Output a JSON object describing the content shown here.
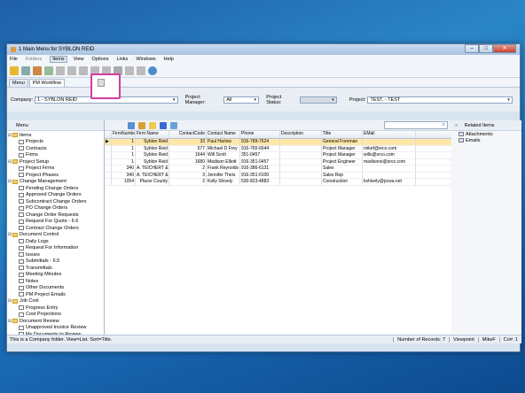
{
  "window": {
    "title": "1 Main Menu for SYBLON REID",
    "minimize": "–",
    "maximize": "□",
    "close": "✕"
  },
  "menubar": [
    {
      "label": "File"
    },
    {
      "label": "Folders"
    },
    {
      "label": "Items"
    },
    {
      "label": "View"
    },
    {
      "label": "Options"
    },
    {
      "label": "Links"
    },
    {
      "label": "Windows"
    },
    {
      "label": "Help"
    }
  ],
  "tabs": [
    {
      "label": "Menu"
    },
    {
      "label": "PM Workflow"
    }
  ],
  "filters": {
    "company_label": "Company:",
    "company_value": "1 - SYBLON REID",
    "pm_label": "Project Manager:",
    "pm_value": "All",
    "status_label": "Project Status:",
    "status_value": "",
    "project_label": "Project:",
    "project_value": "TEST. - TEST"
  },
  "left": {
    "header": "Menu",
    "tree": [
      {
        "label": "Items",
        "level": 0,
        "type": "folder"
      },
      {
        "label": "Projects",
        "level": 1
      },
      {
        "label": "Contracts",
        "level": 1
      },
      {
        "label": "Firms",
        "level": 1
      },
      {
        "label": "Project Setup",
        "level": 0,
        "type": "folder"
      },
      {
        "label": "Project Firms",
        "level": 1
      },
      {
        "label": "Project Phases",
        "level": 1
      },
      {
        "label": "Change Management",
        "level": 0,
        "type": "folder"
      },
      {
        "label": "Pending Change Orders",
        "level": 1
      },
      {
        "label": "Approved Change Orders",
        "level": 1
      },
      {
        "label": "Subcontract Change Orders",
        "level": 1
      },
      {
        "label": "PO Change Orders",
        "level": 1
      },
      {
        "label": "Change Order Requests",
        "level": 1
      },
      {
        "label": "Request For Quote - 6.6",
        "level": 1
      },
      {
        "label": "Contract Change Orders",
        "level": 1
      },
      {
        "label": "Document Control",
        "level": 0,
        "type": "folder"
      },
      {
        "label": "Daily Logs",
        "level": 1
      },
      {
        "label": "Request For Information",
        "level": 1
      },
      {
        "label": "Issues",
        "level": 1
      },
      {
        "label": "Submittals - 6.5",
        "level": 1
      },
      {
        "label": "Transmittals",
        "level": 1
      },
      {
        "label": "Meeting Minutes",
        "level": 1
      },
      {
        "label": "Notes",
        "level": 1
      },
      {
        "label": "Other Documents",
        "level": 1
      },
      {
        "label": "PM Project Emails",
        "level": 1
      },
      {
        "label": "Job Cost",
        "level": 0,
        "type": "folder"
      },
      {
        "label": "Progress Entry",
        "level": 1
      },
      {
        "label": "Cost Projections",
        "level": 1
      },
      {
        "label": "Document Review",
        "level": 0,
        "type": "folder"
      },
      {
        "label": "Unapproved Invoice Review",
        "level": 1
      },
      {
        "label": "My Documents to Review",
        "level": 1
      }
    ]
  },
  "grid": {
    "search_icon": "⌕",
    "columns": [
      "",
      "FirmNumber",
      "Firm Name",
      "ContactCode",
      "Contact Name",
      "Phone",
      "Description",
      "Title",
      "EMail"
    ],
    "rows": [
      [
        "▶",
        "1",
        "Syblon Reid",
        "33",
        "Paul   Harlow",
        "916-789-7624",
        "",
        "General Foreman",
        ""
      ],
      [
        "",
        "1",
        "Syblon Reid",
        "677",
        "Michael D Frey",
        "916-765-6644",
        "",
        "Project Manager",
        "mikef@srco.com"
      ],
      [
        "",
        "1",
        "Syblon Reid",
        "1644",
        "Will   Scott",
        "351-0457",
        "",
        "Project Manager",
        "wills@srco.com"
      ],
      [
        "",
        "1",
        "Syblon Reid",
        "1680",
        "Madison   Elliott",
        "916-351-0457",
        "",
        "Project Engineer",
        "madisone@srco.com"
      ],
      [
        "",
        "340",
        "A. TEICHERT &",
        "2",
        "Frank   Reynolds",
        "916-386-6131",
        "",
        "Sales",
        ""
      ],
      [
        "",
        "340",
        "A. TEICHERT &",
        "3",
        "Jennifer   Theis",
        "916-351-0100",
        "",
        "Sales Rep",
        ""
      ],
      [
        "",
        "1054",
        "Placer County",
        "2",
        "Kelly   Shively",
        "530-823-4883",
        "",
        "Construction",
        "kshively@pcwa.net"
      ]
    ]
  },
  "right": {
    "header": "Related Items",
    "chevron": "»",
    "items": [
      {
        "label": "Attachments"
      },
      {
        "label": "Emails"
      }
    ]
  },
  "status": {
    "text": "This is a Company folder. View=List. Sort=Title.",
    "records": "Number of Records: 7",
    "app": "Viewpoint",
    "user": "MikeF",
    "co": "Co#: 1"
  },
  "colors": {
    "highlight_box": "#d23c9e",
    "selected_row": "#ffe7a8",
    "desktop": "#1e5fa8"
  }
}
